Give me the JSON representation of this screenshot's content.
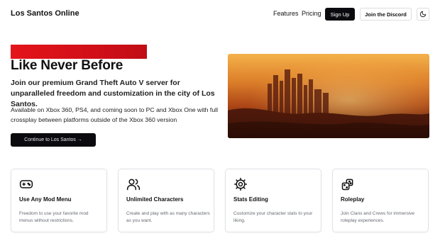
{
  "nav": {
    "brand": "Los Santos Online",
    "links": [
      "Features",
      "Pricing"
    ],
    "signup": "Sign Up",
    "discord": "Join the Discord",
    "theme_icon": "moon-icon"
  },
  "hero": {
    "title": "Like Never Before",
    "lead": "Join our premium Grand Theft Auto V server for unparalleled freedom and customization in the city of Los Santos.",
    "availability": "Available on Xbox 360, PS4, and coming soon to PC and Xbox One with full crossplay between platforms outside of the Xbox 360 version",
    "cta": "Continue to Los Santos →",
    "accent": "#e4141a"
  },
  "features": [
    {
      "icon": "gamepad-icon",
      "title": "Use Any Mod Menu",
      "desc": "Freedom to use your favorite mod menus without restrictions."
    },
    {
      "icon": "users-icon",
      "title": "Unlimited Characters",
      "desc": "Create and play with as many characters as you want."
    },
    {
      "icon": "gear-icon",
      "title": "Stats Editing",
      "desc": "Customize your character stats to your liking."
    },
    {
      "icon": "dice-icon",
      "title": "Roleplay",
      "desc": "Join Clans and Crews for immersive roleplay experiences."
    }
  ]
}
